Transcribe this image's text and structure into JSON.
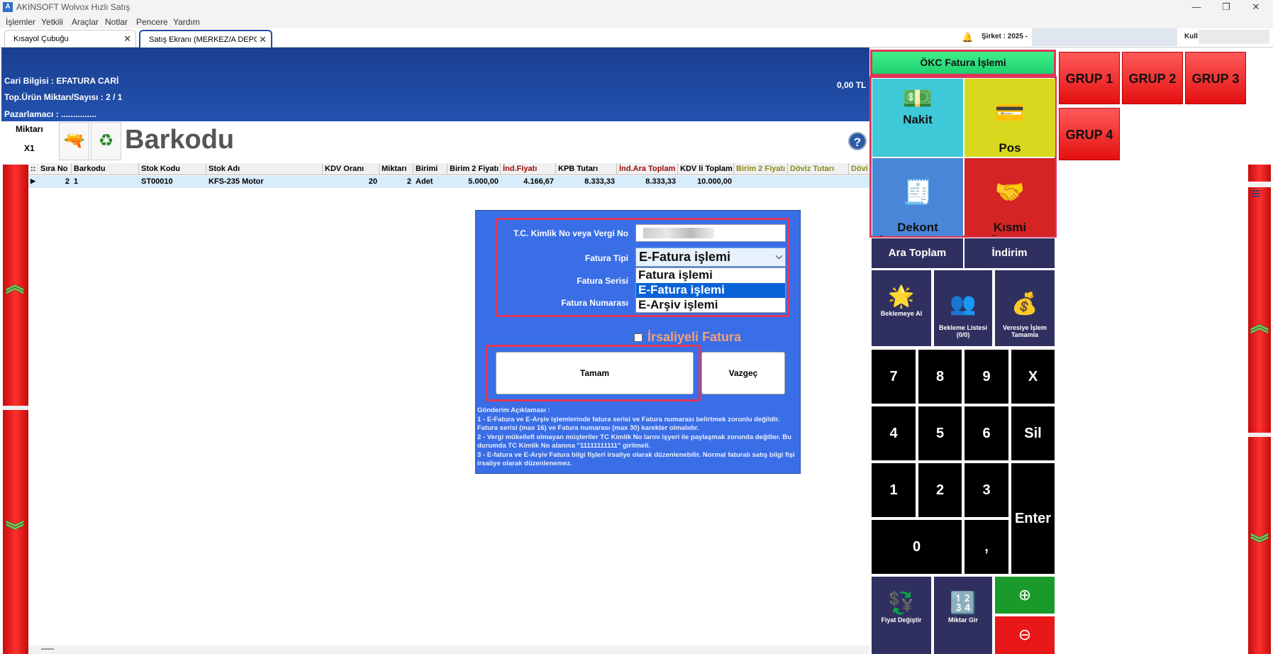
{
  "window": {
    "title": "AKINSOFT Wolvox Hızlı Satış",
    "icon_letter": "A",
    "minimize": "—",
    "maximize": "❐",
    "close": "✕"
  },
  "menu": [
    "İşlemler",
    "Yetkili",
    "Araçlar",
    "Notlar",
    "Pencere",
    "Yardım"
  ],
  "tabs": [
    {
      "label": "Kısayol Çubuğu",
      "close": "✕"
    },
    {
      "label": "Satış Ekranı (MERKEZ/A DEPO",
      "close": "✕"
    }
  ],
  "status": {
    "sirket": "Şirket : 2025 -",
    "kullanici": "Kull"
  },
  "header": {
    "cari": "Cari Bilgisi :  EFATURA CARİ",
    "urun": "Top.Ürün Miktarı/Sayısı :  2  /  1",
    "pazarlamaci": "Pazarlamacı :  ...............",
    "amount": "0,00 TL"
  },
  "barcode": {
    "miktar_label": "Miktarı",
    "miktar_value": "X1",
    "label": "Barkodu",
    "help": "?"
  },
  "grid": {
    "row_marker": "::",
    "columns": [
      "Sıra No",
      "Barkodu",
      "Stok Kodu",
      "Stok Adı",
      "KDV Oranı",
      "Miktarı",
      "Birimi",
      "Birim 2 Fiyatı",
      "İnd.Fiyatı",
      "KPB Tutarı",
      "İnd.Ara Toplam",
      "KDV li Toplam",
      "Birim 2 Fiyatı",
      "Döviz Tutarı",
      "Dövi"
    ],
    "rows": [
      [
        "2",
        "1",
        "ST00010",
        "KFS-235 Motor",
        "20",
        "2",
        "Adet",
        "5.000,00",
        "4.166,67",
        "8.333,33",
        "8.333,33",
        "10.000,00",
        "",
        "",
        ""
      ]
    ],
    "row_pointer": "▶"
  },
  "dialog": {
    "tc_label": "T.C. Kimlik No veya Vergi No",
    "fatura_tipi_label": "Fatura Tipi",
    "fatura_tipi_value": "E-Fatura işlemi",
    "fatura_serisi_label": "Fatura Serisi",
    "fatura_numarasi_label": "Fatura Numarası",
    "options": [
      "Fatura işlemi",
      "E-Fatura işlemi",
      "E-Arşiv işlemi"
    ],
    "selected_option": 1,
    "combo_arrow": "⌵",
    "irsaliye_label": "İrsaliyeli Fatura",
    "ok_label": "Tamam",
    "cancel_label": "Vazgeç",
    "notes": [
      "Gönderim Açıklaması :",
      "1 - E-Fatura ve E-Arşiv  işlemlerinde fatura serisi ve Fatura numarası belirtmek zorunlu değildir. Fatura serisi (max 16) ve Fatura numarası (max 30) karekter olmalıdır.",
      "2 - Vergi mükellefi olmayan müşteriler TC Kimlik No larını işyeri ile paylaşmak zorunda değiller. Bu durumda TC Kimlik No alanına \"11111111111\" girilmeli.",
      "3 - E-fatura ve E-Arşiv Fatura bilgi fişleri irsaliye olarak düzenlenebilir. Normal faturalı satış bilgi fişi irsaliye olarak düzenlenemez."
    ]
  },
  "right_panel": {
    "okc": "ÖKC Fatura İşlemi",
    "payments": [
      {
        "label": "Nakit",
        "icon": "💵",
        "color": "#3ec8d8"
      },
      {
        "label": "Pos\nPOS / POS",
        "icon": "💳",
        "color": "#d8d81e"
      },
      {
        "label": "Dekont\nİŞ BANKASI / POS",
        "icon": "🧾",
        "color": "#4a86d8"
      },
      {
        "label": "Kısmi\nÖdeme",
        "icon": "🤝",
        "color": "#d42424"
      }
    ],
    "groups": [
      "GRUP 1",
      "GRUP 2",
      "GRUP 3",
      "GRUP 4"
    ],
    "ara_toplam": "Ara Toplam",
    "indirim": "İndirim",
    "bekleme_al": "Beklemeye Al",
    "bekleme_listesi": "Bekleme Listesi\n(0/0)",
    "veresiye": "Veresiye İşlem\nTamamla",
    "keys": [
      "7",
      "8",
      "9",
      "X",
      "4",
      "5",
      "6",
      "Sil",
      "1",
      "2",
      "3",
      "Enter",
      "0",
      ","
    ],
    "fiyat_degistir": "Fiyat Değiştir",
    "miktar_gir": "Miktar Gir",
    "plus": "⊕",
    "minus": "⊖",
    "menu": "≡"
  },
  "colors": {
    "header_blue": "#1a3f8f",
    "dialog_blue": "#3a6ee6",
    "highlight_red": "#e0365a",
    "okc_green": "#1ed070",
    "dark_button": "#303060"
  }
}
